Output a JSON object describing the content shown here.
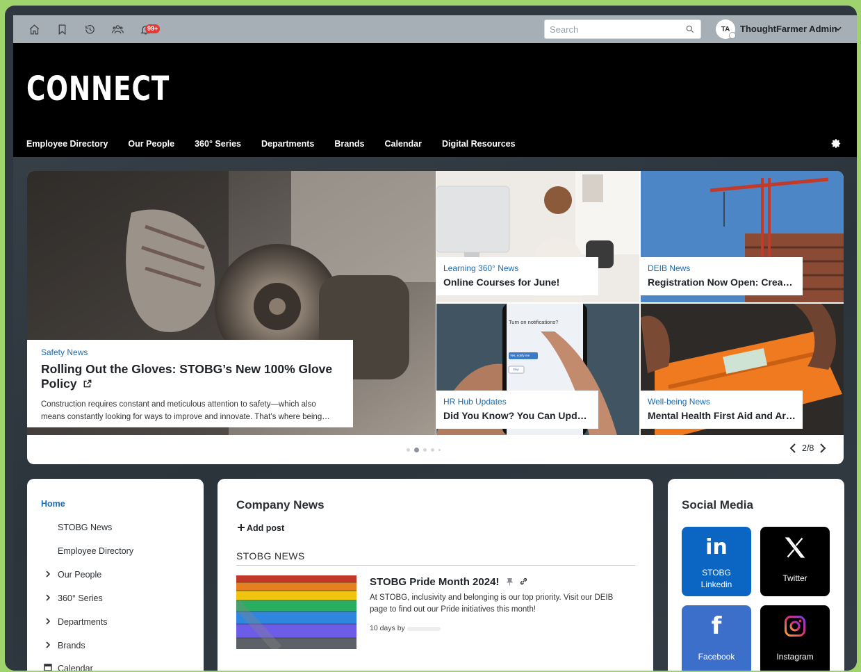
{
  "topbar": {
    "notification_badge": "99+",
    "search_placeholder": "Search",
    "avatar_initials": "TA",
    "user_name": "ThoughtFarmer Admin"
  },
  "header": {
    "site_title": "CONNECT",
    "nav": [
      "Employee Directory",
      "Our People",
      "360° Series",
      "Departments",
      "Brands",
      "Calendar",
      "Digital Resources"
    ]
  },
  "carousel": {
    "hero": {
      "category": "Safety News",
      "title": "Rolling Out the Gloves: STOBG’s New 100% Glove Policy",
      "description": "Construction requires constant and meticulous attention to safety—which also means constantly looking for ways to improve and innovate. That’s where being…"
    },
    "tiles": [
      {
        "category": "Learning 360° News",
        "title": "Online Courses for June!"
      },
      {
        "category": "DEIB News",
        "title": "Registration Now Open: Creati…"
      },
      {
        "category": "HR Hub Updates",
        "title": "Did You Know? You Can Updat…"
      },
      {
        "category": "Well-being News",
        "title": "Mental Health First Aid and Are…"
      }
    ],
    "phone_text": "Turn on notifications?",
    "phone_button": "Yes, notify me",
    "phone_button2": "Skip",
    "pager": "2/8"
  },
  "left_nav": {
    "home": "Home",
    "items": [
      "STOBG News",
      "Employee Directory",
      "Our People",
      "360° Series",
      "Departments",
      "Brands",
      "Calendar"
    ]
  },
  "company_news": {
    "title": "Company News",
    "add_post": "Add post",
    "section": "STOBG NEWS",
    "post": {
      "title": "STOBG Pride Month 2024!",
      "description": "At STOBG, inclusivity and belonging is our top priority. Visit our DEIB page to find out our Pride initiatives this month!",
      "meta": "10 days by"
    }
  },
  "social": {
    "title": "Social Media",
    "items": [
      {
        "label": "STOBG Linkedin",
        "line1": "STOBG",
        "line2": "Linkedin",
        "color": "#0a66c2"
      },
      {
        "label": "Twitter",
        "color": "#000000"
      },
      {
        "label": "Facebook",
        "color": "#3b6fc9"
      },
      {
        "label": "Instagram",
        "color": "#000000"
      }
    ]
  },
  "colors": {
    "accent": "#1b6bb0",
    "badge": "#e53935",
    "frame": "#9fd36e"
  }
}
